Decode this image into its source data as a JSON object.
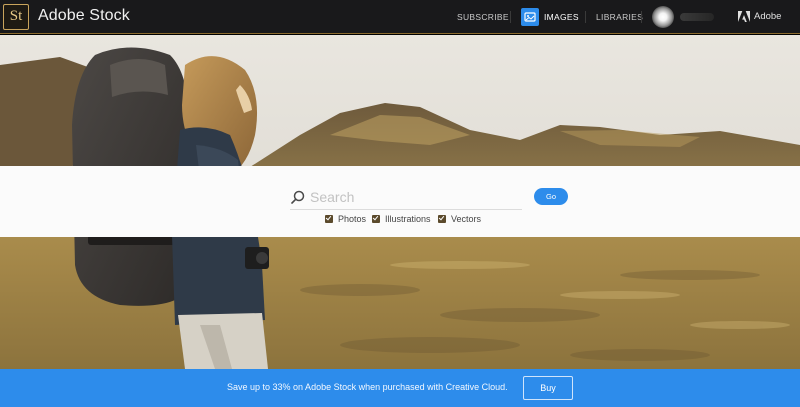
{
  "header": {
    "logo_mark": "St",
    "brand": "Adobe Stock",
    "nav": {
      "subscribe": "SUBSCRIBE",
      "images": "IMAGES",
      "libraries": "LIBRARIES"
    },
    "adobe_label": "Adobe"
  },
  "search": {
    "placeholder": "Search",
    "value": "",
    "go_label": "Go",
    "filters": [
      {
        "label": "Photos",
        "checked": true
      },
      {
        "label": "Illustrations",
        "checked": true
      },
      {
        "label": "Vectors",
        "checked": true
      }
    ]
  },
  "promo": {
    "text": "Save up to 33% on Adobe Stock when purchased with Creative Cloud.",
    "buy_label": "Buy"
  },
  "colors": {
    "accent_blue": "#2d8ceb",
    "topbar": "#19191b",
    "logo_gold": "#c9a45c"
  },
  "icons": [
    "search-icon",
    "images-icon",
    "adobe-logo-icon",
    "checkbox-icon"
  ]
}
